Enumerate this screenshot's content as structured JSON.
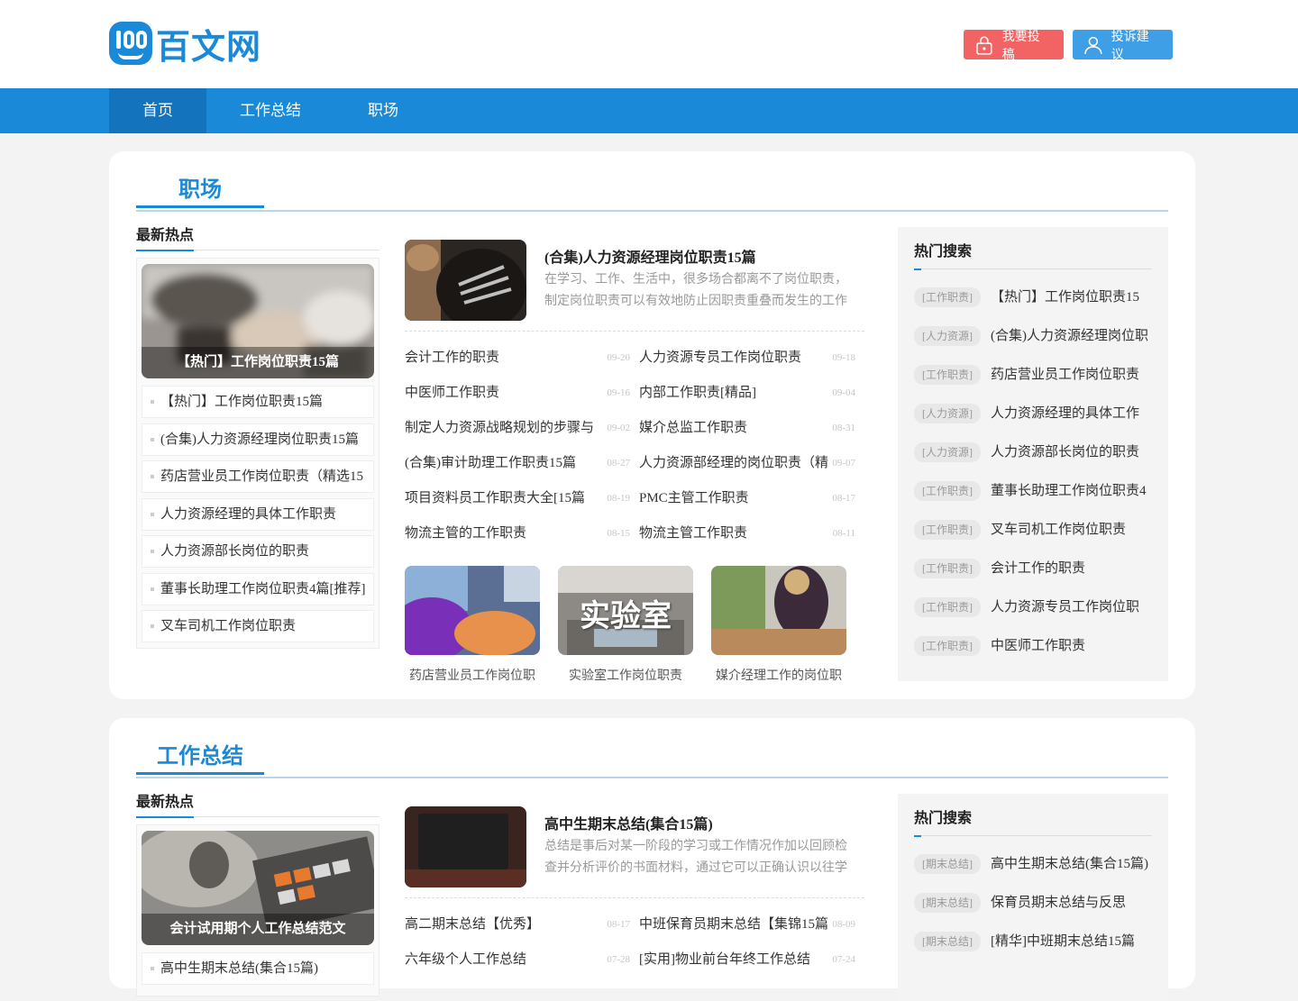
{
  "brand": {
    "name": "百文网",
    "color": "#1a8ad8"
  },
  "header": {
    "submit_label": "我要投稿",
    "complain_label": "投诉建议"
  },
  "nav": {
    "items": [
      "首页",
      "工作总结",
      "职场"
    ],
    "active": "首页"
  },
  "sections": [
    {
      "title": "职场",
      "hot": {
        "heading": "最新热点",
        "feature_caption": "【热门】工作岗位职责15篇",
        "items": [
          "【热门】工作岗位职责15篇",
          "(合集)人力资源经理岗位职责15篇",
          "药店营业员工作岗位职责（精选15",
          "人力资源经理的具体工作职责",
          "人力资源部长岗位的职责",
          "董事长助理工作岗位职责4篇[推荐]",
          "叉车司机工作岗位职责"
        ]
      },
      "lead": {
        "title": "(合集)人力资源经理岗位职责15篇",
        "desc": "在学习、工作、生活中，很多场合都离不了岗位职责，制定岗位职责可以有效地防止因职责重叠而发生的工作"
      },
      "news": [
        {
          "title": "会计工作的职责",
          "date": "09-20"
        },
        {
          "title": "人力资源专员工作岗位职责",
          "date": "09-18"
        },
        {
          "title": "中医师工作职责",
          "date": "09-16"
        },
        {
          "title": "内部工作职责[精品]",
          "date": "09-04"
        },
        {
          "title": "制定人力资源战略规划的步骤与",
          "date": "09-02"
        },
        {
          "title": "媒介总监工作职责",
          "date": "08-31"
        },
        {
          "title": "(合集)审计助理工作职责15篇",
          "date": "08-27"
        },
        {
          "title": "人力资源部经理的岗位职责（精",
          "date": "09-07"
        },
        {
          "title": "项目资料员工作职责大全[15篇",
          "date": "08-19"
        },
        {
          "title": "PMC主管工作职责",
          "date": "08-17"
        },
        {
          "title": "物流主管的工作职责",
          "date": "08-15"
        },
        {
          "title": "物流主管工作职责",
          "date": "08-11"
        }
      ],
      "thumbs": [
        {
          "caption": "药店营业员工作岗位职",
          "overlay": ""
        },
        {
          "caption": "实验室工作岗位职责",
          "overlay": "实验室"
        },
        {
          "caption": "媒介经理工作的岗位职",
          "overlay": ""
        }
      ],
      "search": {
        "heading": "热门搜索",
        "items": [
          {
            "tag": "[工作职责]",
            "text": "【热门】工作岗位职责15"
          },
          {
            "tag": "[人力资源]",
            "text": "(合集)人力资源经理岗位职"
          },
          {
            "tag": "[工作职责]",
            "text": "药店营业员工作岗位职责"
          },
          {
            "tag": "[人力资源]",
            "text": "人力资源经理的具体工作"
          },
          {
            "tag": "[人力资源]",
            "text": "人力资源部长岗位的职责"
          },
          {
            "tag": "[工作职责]",
            "text": "董事长助理工作岗位职责4"
          },
          {
            "tag": "[工作职责]",
            "text": "叉车司机工作岗位职责"
          },
          {
            "tag": "[工作职责]",
            "text": "会计工作的职责"
          },
          {
            "tag": "[工作职责]",
            "text": "人力资源专员工作岗位职"
          },
          {
            "tag": "[工作职责]",
            "text": "中医师工作职责"
          }
        ]
      }
    },
    {
      "title": "工作总结",
      "hot": {
        "heading": "最新热点",
        "feature_caption": "会计试用期个人工作总结范文",
        "items": [
          "高中生期末总结(集合15篇)"
        ]
      },
      "lead": {
        "title": "高中生期末总结(集合15篇)",
        "desc": "总结是事后对某一阶段的学习或工作情况作加以回顾检查并分析评价的书面材料，通过它可以正确认识以往学"
      },
      "news": [
        {
          "title": "高二期末总结【优秀】",
          "date": "08-17"
        },
        {
          "title": "中班保育员期末总结【集锦15篇",
          "date": "08-09"
        },
        {
          "title": "六年级个人工作总结",
          "date": "07-28"
        },
        {
          "title": "[实用]物业前台年终工作总结",
          "date": "07-24"
        }
      ],
      "search": {
        "heading": "热门搜索",
        "items": [
          {
            "tag": "[期末总结]",
            "text": "高中生期末总结(集合15篇)"
          },
          {
            "tag": "[期末总结]",
            "text": "保育员期末总结与反思"
          },
          {
            "tag": "[期末总结]",
            "text": "[精华]中班期末总结15篇"
          }
        ]
      }
    }
  ]
}
